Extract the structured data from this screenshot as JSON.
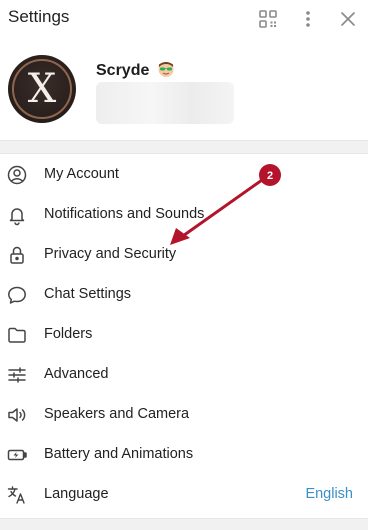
{
  "header": {
    "title": "Settings",
    "icons": [
      "qr-code-icon",
      "more-vertical-icon",
      "close-icon"
    ]
  },
  "profile": {
    "name": "Scryde",
    "avatar_letter": "X",
    "emoji_icon": "sunglasses-face-icon"
  },
  "menu": {
    "items": [
      {
        "label": "My Account",
        "icon": "user-circle-icon"
      },
      {
        "label": "Notifications and Sounds",
        "icon": "bell-icon"
      },
      {
        "label": "Privacy and Security",
        "icon": "lock-icon"
      },
      {
        "label": "Chat Settings",
        "icon": "chat-bubble-icon"
      },
      {
        "label": "Folders",
        "icon": "folder-icon"
      },
      {
        "label": "Advanced",
        "icon": "sliders-icon"
      },
      {
        "label": "Speakers and Camera",
        "icon": "speaker-icon"
      },
      {
        "label": "Battery and Animations",
        "icon": "battery-icon"
      },
      {
        "label": "Language",
        "icon": "translate-icon",
        "value": "English"
      }
    ]
  },
  "annotation": {
    "badge_number": "2",
    "color": "#b3142c"
  },
  "colors": {
    "accent_link": "#3a8fc8",
    "separator": "#f1f1f1"
  }
}
